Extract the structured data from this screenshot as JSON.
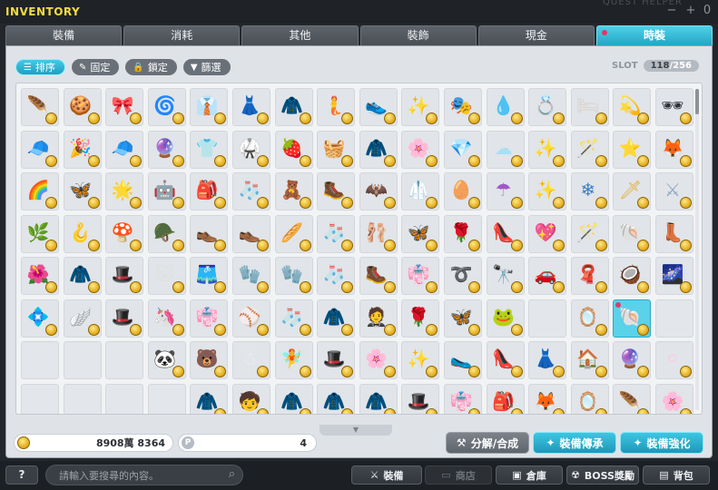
{
  "window": {
    "title": "INVENTORY",
    "helper_label": "QUEST HELPER",
    "helper_count": "0",
    "minimize_label": "+",
    "close_label": "−"
  },
  "tabs": [
    {
      "label": "裝備",
      "active": false
    },
    {
      "label": "消耗",
      "active": false
    },
    {
      "label": "其他",
      "active": false
    },
    {
      "label": "裝飾",
      "active": false
    },
    {
      "label": "現金",
      "active": false
    },
    {
      "label": "時裝",
      "active": true
    }
  ],
  "filters": [
    {
      "label": "排序",
      "icon": "sort-icon",
      "glyph": "☰",
      "active": true
    },
    {
      "label": "固定",
      "icon": "pin-icon",
      "glyph": "✎",
      "active": false
    },
    {
      "label": "鎖定",
      "icon": "lock-icon",
      "glyph": "🔒",
      "active": false
    },
    {
      "label": "篩選",
      "icon": "filter-icon",
      "glyph": "▼",
      "active": false
    }
  ],
  "slot": {
    "label": "SLOT",
    "used": "118",
    "separator": "/",
    "total": "256"
  },
  "items": [
    {
      "g": "🪶",
      "c": "#5ad0e8"
    },
    {
      "g": "🍪",
      "c": "#b5713a"
    },
    {
      "g": "🎀",
      "c": "#f4c6d8"
    },
    {
      "g": "🌀",
      "c": "#6b7d8c"
    },
    {
      "g": "👔",
      "c": "#e8e8ea"
    },
    {
      "g": "👗",
      "c": "#f2d4b6"
    },
    {
      "g": "🧥",
      "c": "#2c3b6d"
    },
    {
      "g": "🧜",
      "c": "#3ab8c8"
    },
    {
      "g": "👟",
      "c": "#3a3a55"
    },
    {
      "g": "✨",
      "c": "#c978e8"
    },
    {
      "g": "🎭",
      "c": "#b86cd0"
    },
    {
      "g": "💧",
      "c": "#8fb4e8"
    },
    {
      "g": "💍",
      "c": "#e6b820"
    },
    {
      "g": "🛏",
      "c": "#d8d0c8"
    },
    {
      "g": "💫",
      "c": "#5a6ae6"
    },
    {
      "g": "🕶",
      "c": "#2c2f38"
    },
    {
      "g": "🧢",
      "c": "#ececec"
    },
    {
      "g": "🎉",
      "c": "#ee4a6a"
    },
    {
      "g": "🧢",
      "c": "#efe6c8"
    },
    {
      "g": "🔮",
      "c": "#b06ce4"
    },
    {
      "g": "👕",
      "c": "#cde6f2"
    },
    {
      "g": "🥋",
      "c": "#2c3550"
    },
    {
      "g": "🍓",
      "c": "#d8d8d8"
    },
    {
      "g": "🧺",
      "c": "#5a4640"
    },
    {
      "g": "🧥",
      "c": "#3c4a60"
    },
    {
      "g": "🌸",
      "c": "#6d7cb0"
    },
    {
      "g": "💎",
      "c": "#6ac8ee"
    },
    {
      "g": "☁",
      "c": "#a6e0f6"
    },
    {
      "g": "✨",
      "c": "#e6873c"
    },
    {
      "g": "🪄",
      "c": "#40b8d8"
    },
    {
      "g": "⭐",
      "c": "#f0c040"
    },
    {
      "g": "🦊",
      "c": "#f0a070"
    },
    {
      "g": "🌈",
      "c": "#a0b8e8"
    },
    {
      "g": "🦋",
      "c": "#80d0f0"
    },
    {
      "g": "🌟",
      "c": "#a880e0"
    },
    {
      "g": "🤖",
      "c": "#4a84e0"
    },
    {
      "g": "🎒",
      "c": "#f0a8c8"
    },
    {
      "g": "🧦",
      "c": "#d0e8f0"
    },
    {
      "g": "🧸",
      "c": "#f4b0c8"
    },
    {
      "g": "🥾",
      "c": "#a0e0a8"
    },
    {
      "g": "🦇",
      "c": "#909090"
    },
    {
      "g": "🥼",
      "c": "#f0f0f0"
    },
    {
      "g": "🥚",
      "c": "#e8e8ee"
    },
    {
      "g": "☂",
      "c": "#a058c8"
    },
    {
      "g": "✨",
      "c": "#e0a030"
    },
    {
      "g": "❄",
      "c": "#3a80c8"
    },
    {
      "g": "🗡",
      "c": "#e0b040"
    },
    {
      "g": "⚔",
      "c": "#90a8c0"
    },
    {
      "g": "🌿",
      "c": "#2a2a2a"
    },
    {
      "g": "🪝",
      "c": "#e89030"
    },
    {
      "g": "🍄",
      "c": "#f0a020"
    },
    {
      "g": "🪖",
      "c": "#6a4a30"
    },
    {
      "g": "👞",
      "c": "#3a4860"
    },
    {
      "g": "👞",
      "c": "#a8c0e0"
    },
    {
      "g": "🥖",
      "c": "#e8c090"
    },
    {
      "g": "🧦",
      "c": "#3a3a3a"
    },
    {
      "g": "🩰",
      "c": "#f0c0d8"
    },
    {
      "g": "🦋",
      "c": "#d090f0"
    },
    {
      "g": "🌹",
      "c": "#a040c0"
    },
    {
      "g": "👠",
      "c": "#7050c0"
    },
    {
      "g": "💖",
      "c": "#f080c0"
    },
    {
      "g": "🪄",
      "c": "#b070d0"
    },
    {
      "g": "🐚",
      "c": "#303848"
    },
    {
      "g": "👢",
      "c": "#703030"
    },
    {
      "g": "🌺",
      "c": "#5070b0"
    },
    {
      "g": "🧥",
      "c": "#1a1a28"
    },
    {
      "g": "🎩",
      "c": "#2a2a2a"
    },
    {
      "g": "🐱",
      "c": "#e0e0e0"
    },
    {
      "g": "🩳",
      "c": "#a0d8f0"
    },
    {
      "g": "🧤",
      "c": "#f0f0f4"
    },
    {
      "g": "🧤",
      "c": "#1a1a1a"
    },
    {
      "g": "🧦",
      "c": "#f8c0d8"
    },
    {
      "g": "🥾",
      "c": "#1a1a1a"
    },
    {
      "g": "👘",
      "c": "#c8b0e8"
    },
    {
      "g": "➰",
      "c": "#303030"
    },
    {
      "g": "🔭",
      "c": "#60a0b8"
    },
    {
      "g": "🚗",
      "c": "#1a1a2a"
    },
    {
      "g": "🧣",
      "c": "#a07060"
    },
    {
      "g": "🥥",
      "c": "#6a4028"
    },
    {
      "g": "🌌",
      "c": "#e080e0"
    },
    {
      "g": "💠",
      "c": "#80d0f0"
    },
    {
      "g": "🪽",
      "c": "#e0c040"
    },
    {
      "g": "🎩",
      "c": "#e8e8ec"
    },
    {
      "g": "🦄",
      "c": "#d0c0e8"
    },
    {
      "g": "👘",
      "c": "#b0d8e8"
    },
    {
      "g": "⚾",
      "c": "#f0f0f0"
    },
    {
      "g": "🧦",
      "c": "#3a3a3a"
    },
    {
      "g": "🧥",
      "c": "#f0e0c0"
    },
    {
      "g": "🤵",
      "c": "#1a1a3a"
    },
    {
      "g": "🌹",
      "c": "#a040c0"
    },
    {
      "g": "🦋",
      "c": "#e0a0e8"
    },
    {
      "g": "🐸",
      "c": "#60e0c8"
    },
    null,
    {
      "g": "🪞",
      "c": "#8090a8"
    },
    {
      "g": "🐚",
      "c": "#e8b0d0",
      "selected": true,
      "mark": true
    },
    null,
    null,
    null,
    null,
    {
      "g": "🐼",
      "c": "#f0f0f0"
    },
    {
      "g": "🐻",
      "c": "#f090c0"
    },
    {
      "g": "☃",
      "c": "#f0f0f4"
    },
    {
      "g": "🧚",
      "c": "#d0e8f8"
    },
    {
      "g": "🎩",
      "c": "#6a4a30"
    },
    {
      "g": "🌸",
      "c": "#f0c0d0"
    },
    {
      "g": "✨",
      "c": "#8040c0"
    },
    {
      "g": "🥿",
      "c": "#703040"
    },
    {
      "g": "👠",
      "c": "#8050c0"
    },
    {
      "g": "👗",
      "c": "#c0a0e0"
    },
    {
      "g": "🏠",
      "c": "#c03030"
    },
    {
      "g": "🔮",
      "c": "#6080e0"
    },
    {
      "g": "⚪",
      "c": "#f8d0e0"
    },
    null,
    null,
    null,
    null,
    {
      "g": "🧥",
      "c": "#c0e0e8"
    },
    {
      "g": "🧒",
      "c": "#f0e060"
    },
    {
      "g": "🧥",
      "c": "#f0f0f0"
    },
    {
      "g": "🧥",
      "c": "#f8c0d8"
    },
    {
      "g": "🧥",
      "c": "#e8d8d0"
    },
    {
      "g": "🎩",
      "c": "#1a1a1a"
    },
    {
      "g": "👘",
      "c": "#e0e8f0"
    },
    {
      "g": "🎒",
      "c": "#703090"
    },
    {
      "g": "🦊",
      "c": "#e08040"
    },
    {
      "g": "🪞",
      "c": "#404040"
    },
    {
      "g": "🪶",
      "c": "#60d8e8"
    },
    {
      "g": "🌸",
      "c": "#e04080"
    },
    {
      "g": "🍁",
      "c": "#d08030"
    },
    null,
    null,
    null,
    null
  ],
  "currency": {
    "meso": "8908萬 8364",
    "points_label": "P",
    "points": "4"
  },
  "actions": [
    {
      "label": "分解/合成",
      "icon": "hammer-icon",
      "glyph": "⚒",
      "style": "gray"
    },
    {
      "label": "裝備傳承",
      "icon": "transfer-icon",
      "glyph": "✦",
      "style": "blue"
    },
    {
      "label": "裝備強化",
      "icon": "enhance-icon",
      "glyph": "✦",
      "style": "blue"
    }
  ],
  "bottom": {
    "help_label": "?",
    "search_placeholder": "請輸入要搜尋的內容。",
    "buttons": [
      {
        "label": "裝備",
        "icon": "equip-icon",
        "glyph": "⚔",
        "disabled": false
      },
      {
        "label": "商店",
        "icon": "shop-icon",
        "glyph": "▭",
        "disabled": true
      },
      {
        "label": "倉庫",
        "icon": "storage-icon",
        "glyph": "▣",
        "disabled": false
      },
      {
        "label": "BOSS獎勵",
        "icon": "boss-reward-icon",
        "glyph": "☢",
        "disabled": false
      },
      {
        "label": "背包",
        "icon": "bag-icon",
        "glyph": "▤",
        "disabled": false
      }
    ]
  }
}
